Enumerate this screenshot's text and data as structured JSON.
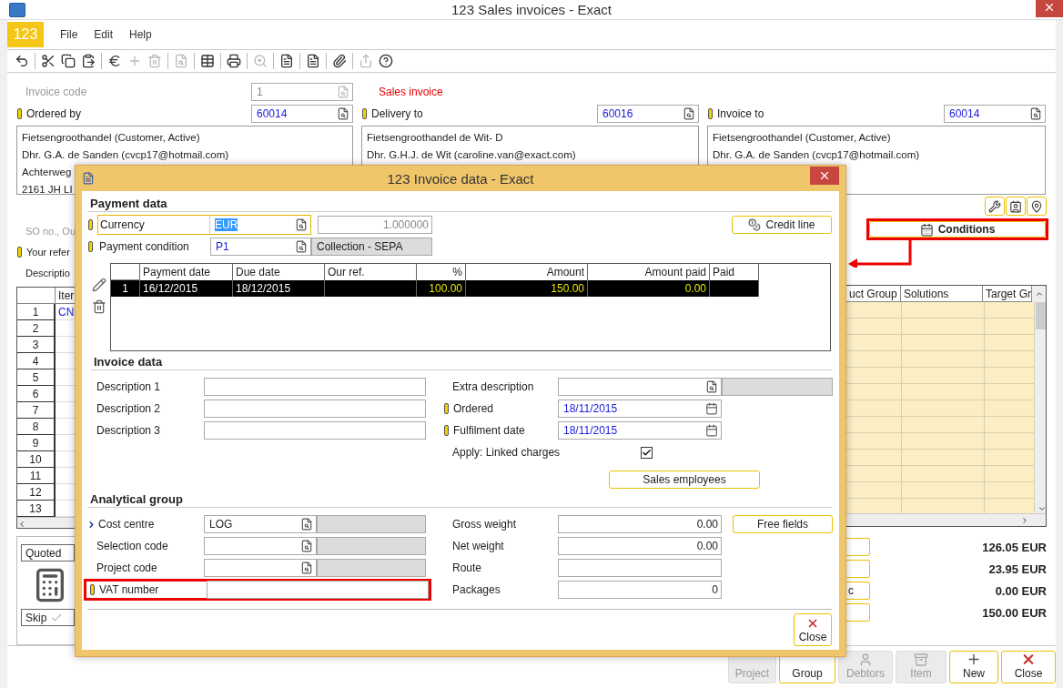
{
  "window": {
    "title": "123 Sales invoices - Exact"
  },
  "menu": {
    "badge": "123",
    "items": [
      "File",
      "Edit",
      "Help"
    ]
  },
  "toolbar": [
    [
      {
        "kind": "undo",
        "disabled": false
      }
    ],
    [
      {
        "kind": "cut",
        "disabled": false
      },
      {
        "kind": "copy",
        "disabled": false
      },
      {
        "kind": "paste",
        "disabled": false
      }
    ],
    [
      {
        "kind": "euro",
        "disabled": false
      },
      {
        "kind": "add",
        "disabled": true
      },
      {
        "kind": "delete",
        "disabled": true
      }
    ],
    [
      {
        "kind": "preview",
        "disabled": true
      }
    ],
    [
      {
        "kind": "table",
        "disabled": false
      }
    ],
    [
      {
        "kind": "print",
        "disabled": false
      }
    ],
    [
      {
        "kind": "zoom",
        "disabled": true
      }
    ],
    [
      {
        "kind": "note",
        "disabled": false
      }
    ],
    [
      {
        "kind": "note",
        "disabled": false
      }
    ],
    [
      {
        "kind": "attach",
        "disabled": false
      }
    ],
    [
      {
        "kind": "export",
        "disabled": true
      },
      {
        "kind": "help",
        "disabled": false
      }
    ]
  ],
  "header": {
    "invoice_code": {
      "label": "Invoice code",
      "value": "1",
      "disabled": true
    },
    "document_type": "Sales invoice",
    "parties": [
      {
        "label": "Ordered by",
        "required": true,
        "value": "60014",
        "address": [
          "Fietsengroothandel (Customer, Active)",
          "Dhr. G.A. de Sanden (cvcp17@hotmail.com)",
          "Achterweg",
          "2161 JH  LI"
        ]
      },
      {
        "label": "Delivery to",
        "required": true,
        "value": "60016",
        "address": [
          "Fietsengroothandel de Wit- D",
          "Dhr. G.H.J. de Wit (caroline.van@exact.com)"
        ]
      },
      {
        "label": "Invoice to",
        "required": true,
        "value": "60014",
        "address": [
          "Fietsengroothandel (Customer, Active)",
          "Dhr. G.A. de Sanden (cvcp17@hotmail.com)"
        ]
      }
    ]
  },
  "side_fields": [
    {
      "label": "SO no., Ou",
      "disabled": true
    },
    {
      "label": "Your refer",
      "disabled": false,
      "required": true
    },
    {
      "label": "Descriptio",
      "disabled": false
    }
  ],
  "lines": {
    "columns": [
      "Iter"
    ],
    "rows": [
      {
        "number": "1",
        "item": "CN"
      },
      {
        "number": "2"
      },
      {
        "number": "3"
      },
      {
        "number": "4"
      },
      {
        "number": "5"
      },
      {
        "number": "6"
      },
      {
        "number": "7"
      },
      {
        "number": "8"
      },
      {
        "number": "9"
      },
      {
        "number": "10"
      },
      {
        "number": "11"
      },
      {
        "number": "12"
      },
      {
        "number": "13"
      }
    ]
  },
  "status_panel": {
    "status": "Quoted",
    "skip": {
      "label": "Skip",
      "checked": true
    }
  },
  "conditions": {
    "label": "Conditions",
    "highlighted": true
  },
  "extra_grid": {
    "columns": [
      "uct Group",
      "Solutions",
      "Target Gr"
    ]
  },
  "totals": [
    {
      "amount": "126.05 EUR"
    },
    {
      "amount": "23.95 EUR"
    },
    {
      "field_text": "c",
      "amount": "0.00 EUR"
    },
    {
      "amount": "150.00 EUR"
    }
  ],
  "actions": [
    {
      "kind": "none",
      "label": "Project",
      "disabled": true
    },
    {
      "kind": "none",
      "label": "Group",
      "disabled": false
    },
    {
      "kind": "user",
      "label": "Debtors",
      "disabled": true
    },
    {
      "kind": "item",
      "label": "Item",
      "disabled": true
    },
    {
      "kind": "new",
      "label": "New",
      "disabled": false
    },
    {
      "kind": "close",
      "label": "Close",
      "disabled": false
    }
  ],
  "dialog": {
    "title": "123 Invoice data - Exact",
    "payment": {
      "heading": "Payment data",
      "currency": {
        "label": "Currency",
        "required": true,
        "value": "EUR",
        "focused": true,
        "rate": "1.000000"
      },
      "payment_condition": {
        "label": "Payment condition",
        "required": true,
        "value": "P1",
        "description": "Collection - SEPA"
      },
      "credit_line": "Credit line",
      "table": {
        "columns": [
          "Payment date",
          "Due date",
          "Our ref.",
          "%",
          "Amount",
          "Amount paid",
          "Paid"
        ],
        "rows": [
          {
            "number": "1",
            "selected": true,
            "payment_date": "16/12/2015",
            "due_date": "18/12/2015",
            "percent": "100.00",
            "amount": "150.00",
            "amount_paid": "0.00"
          }
        ]
      }
    },
    "invoice": {
      "heading": "Invoice data",
      "descriptions": [
        {
          "label": "Description 1"
        },
        {
          "label": "Description 2"
        },
        {
          "label": "Description 3"
        }
      ],
      "extra_description": {
        "label": "Extra description"
      },
      "ordered": {
        "label": "Ordered",
        "required": true,
        "value": "18/11/2015"
      },
      "fulfilment": {
        "label": "Fulfilment date",
        "required": true,
        "value": "18/11/2015"
      },
      "linked_charges": {
        "label": "Apply: Linked charges",
        "checked": true
      },
      "sales_employees": "Sales employees"
    },
    "analytical": {
      "heading": "Analytical group",
      "cost_centre": {
        "label": "Cost centre",
        "linked": true,
        "value": "LOG"
      },
      "selection_code": {
        "label": "Selection code"
      },
      "project_code": {
        "label": "Project code"
      },
      "vat_number": {
        "label": "VAT number",
        "required": true,
        "highlighted": true
      },
      "gross_weight": {
        "label": "Gross weight",
        "value": "0.00"
      },
      "net_weight": {
        "label": "Net weight",
        "value": "0.00"
      },
      "route": {
        "label": "Route"
      },
      "packages": {
        "label": "Packages",
        "value": "0"
      },
      "free_fields": "Free fields"
    },
    "close": "Close"
  }
}
